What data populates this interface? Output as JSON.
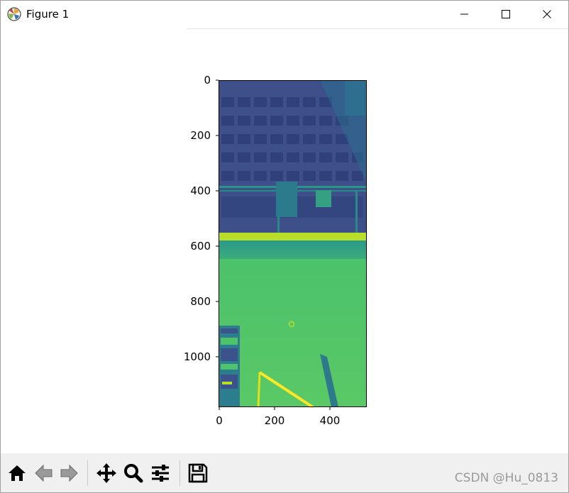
{
  "window": {
    "title": "Figure 1",
    "app_icon": "matplotlib-icon",
    "controls": [
      "minimize-icon",
      "maximize-icon",
      "close-icon"
    ]
  },
  "axes": {
    "x_ticks": [
      "0",
      "200",
      "400"
    ],
    "y_ticks": [
      "0",
      "200",
      "400",
      "600",
      "800",
      "1000"
    ],
    "xlim": [
      0,
      533
    ],
    "ylim": [
      1183,
      0
    ],
    "colormap": "viridis"
  },
  "toolbar": {
    "buttons": [
      {
        "icon": "home-icon"
      },
      {
        "icon": "back-arrow-icon"
      },
      {
        "icon": "forward-arrow-icon"
      },
      {
        "icon": "pan-icon"
      },
      {
        "icon": "zoom-icon"
      },
      {
        "icon": "configure-subplots-icon"
      },
      {
        "icon": "save-icon"
      }
    ]
  },
  "watermark": "CSDN @Hu_0813",
  "colors": {
    "viridis_dark": "#3b528b",
    "viridis_teal": "#2a9d8e",
    "viridis_green": "#4ec36b",
    "viridis_yellow": "#fde725",
    "toolbar_bg": "#f0f0f0"
  }
}
